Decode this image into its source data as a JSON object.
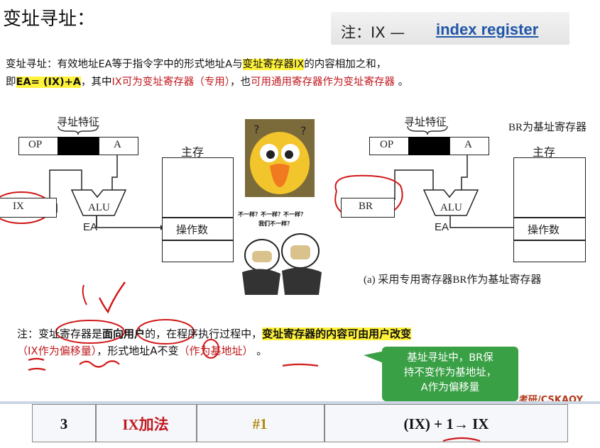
{
  "heading": {
    "title": "变址寻址："
  },
  "register_note": {
    "prefix": "注：IX —",
    "link": "index register"
  },
  "definition": {
    "l1_a": "变址寻址：有效地址EA等于指令字中的形式地址A与",
    "l1_hl": "变址寄存器IX",
    "l1_b": "的内容相加之和，",
    "l2_a": "即",
    "l2_hl": "EA= (IX)+A",
    "l2_b": "，其中",
    "l2_r1": "IX可为变址寄存器（专用）",
    "l2_c": "，也",
    "l2_r2": "可用通用寄存器作为变址寄存器",
    "l2_d": " 。"
  },
  "left_diagram": {
    "feature_label": "寻址特征",
    "op": "OP",
    "a": "A",
    "memory_title": "主存",
    "reg": "IX",
    "alu": "ALU",
    "ea": "EA",
    "operand": "操作数"
  },
  "right_diagram": {
    "feature_label": "寻址特征",
    "title": "BR为基址寄存器",
    "op": "OP",
    "a": "A",
    "memory_title": "主存",
    "reg": "BR",
    "alu": "ALU",
    "ea": "EA",
    "operand": "操作数",
    "caption": "(a) 采用专用寄存器BR作为基址寄存器"
  },
  "meme": {
    "line1": "不一样？不一样？不一样？",
    "line2": "我们不一样？"
  },
  "note": {
    "a": "注：",
    "b": "变址寄存器",
    "c": "是",
    "d": "面向用户",
    "e": "的，在程序执行过程中，",
    "hl": "变址寄存器的内容可由用户改变",
    "r1": "（IX作为偏移量）",
    "f": "，形式地址",
    "g": "A",
    "h": "不变",
    "r2": "（作为基地址）",
    "i": " 。"
  },
  "bubble": {
    "l1": "基址寻址中，BR保",
    "l2": "持不变作为基地址，",
    "l3": "A作为偏移量"
  },
  "watermark": "考研/CSKAOY",
  "table_row": {
    "num": "3",
    "name": "IX加法",
    "op": "#1",
    "expr": "(IX) + 1→ IX"
  },
  "colors": {
    "highlight": "#fff23a",
    "red": "#c0191e",
    "link": "#1f56a8",
    "bubble": "#3aa046"
  }
}
